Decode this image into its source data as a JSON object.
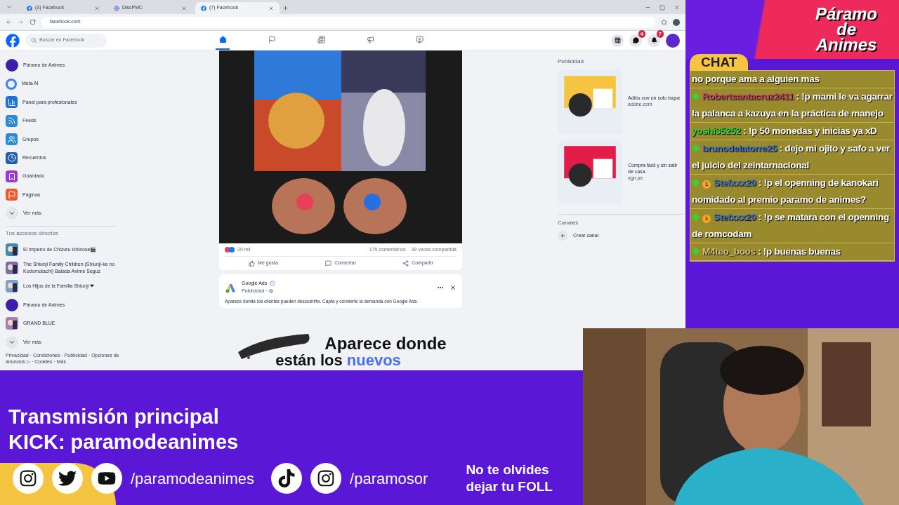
{
  "browser": {
    "tabs": [
      {
        "label": "(3) Facebook",
        "kind": "facebook",
        "selected": false
      },
      {
        "label": "DiscPMC",
        "kind": "disc",
        "selected": false
      },
      {
        "label": "(7) Facebook",
        "kind": "facebook",
        "selected": true
      }
    ],
    "address": "facebook.com"
  },
  "facebook": {
    "search": {
      "placeholder": "Buscar en Facebook"
    },
    "nav": [
      {
        "kind": "home",
        "selected": true
      },
      {
        "kind": "flag",
        "selected": false
      },
      {
        "kind": "news",
        "selected": false
      },
      {
        "kind": "megaphone",
        "selected": false
      },
      {
        "kind": "video",
        "selected": false
      }
    ],
    "header_buttons": [
      {
        "kind": "grid"
      },
      {
        "kind": "messenger",
        "badge": "4"
      },
      {
        "kind": "bell",
        "badge": "7"
      }
    ],
    "sidebar": [
      {
        "label": "Páramo de Animes",
        "kind": "avatar",
        "color": "#3b1fa8"
      },
      {
        "label": "Meta AI",
        "kind": "ring",
        "color": "#3b82f6"
      },
      {
        "label": "Panel para profesionales",
        "kind": "chart",
        "color": "#1d6fe0"
      },
      {
        "label": "Feeds",
        "kind": "feed",
        "color": "#2d88d8"
      },
      {
        "label": "Grupos",
        "kind": "groups",
        "color": "#2d88d8"
      },
      {
        "label": "Recuerdos",
        "kind": "clock",
        "color": "#1e5fb0"
      },
      {
        "label": "Guardado",
        "kind": "bookmark",
        "color": "#9b3bd6"
      },
      {
        "label": "Páginas",
        "kind": "flag",
        "color": "#ea5a2a"
      },
      {
        "label": "Ver más",
        "kind": "chevron",
        "color": "#e4e6eb"
      }
    ],
    "shortcuts_title": "Tus accesos directos",
    "shortcuts": [
      {
        "label": "El Imperio de Chizuru Ichinose🎬",
        "kind": "thumb",
        "color": "#3e8ca8"
      },
      {
        "label": "The Shiunji Family Children (Shiunji-ke no Kodomotachi) Balada Anime Seguz",
        "kind": "thumb",
        "color": "#7a6fa8"
      },
      {
        "label": "Los Hijos de la Familia Shiunji ❤",
        "kind": "thumb",
        "color": "#7aa0c8"
      },
      {
        "label": "Páramo de Animes",
        "kind": "avatar",
        "color": "#3b1fa8"
      },
      {
        "label": "GRAND BLUE",
        "kind": "thumb",
        "color": "#a880b0"
      },
      {
        "label": "Ver más",
        "kind": "chevron",
        "color": "#e4e6eb"
      }
    ],
    "footer": "Privacidad · Condiciones · Publicidad · Opciones de anuncios ▷ · Cookies · Más",
    "post": {
      "reactions": "20 mil",
      "comments": "179 comentarios",
      "shares": "39 veces compartida",
      "actions": [
        {
          "label": "Me gusta",
          "kind": "like"
        },
        {
          "label": "Comentar",
          "kind": "comment"
        },
        {
          "label": "Compartir",
          "kind": "share"
        }
      ]
    },
    "ad_post": {
      "author": "Google Ads",
      "verified": true,
      "meta": "Publicidad · ",
      "text": "Aparece donde los clientes pueden descubrirte. Capta y convierte la demanda con Google Ads.",
      "headline_1": "Aparece donde",
      "headline_2a": "están los ",
      "headline_2b": "nuevos"
    },
    "right": {
      "title": "Publicidad",
      "ads": [
        {
          "title": "Adiós con un solo toque",
          "domain": "adobe.com",
          "color": "#f5c542"
        },
        {
          "title": "Compra fácil y sin salir de casa",
          "domain": "agn.pe",
          "color": "#e11d48"
        }
      ],
      "channels_title": "Canales",
      "create_channel": "Crear canal"
    }
  },
  "stream": {
    "logo": [
      "Páramo",
      "de",
      "Animes"
    ],
    "chat_title": "CHAT",
    "chat": [
      {
        "kind": "continuation",
        "text": "no porque ama a alguien mas"
      },
      {
        "kind": "member",
        "user": "Robertsantacruz2411",
        "color": "#c0406a",
        "coin": false,
        "text": " : !p mami le va agarrar la palanca a kazuya en la práctica de manejo"
      },
      {
        "kind": "guest",
        "user": "yoshi35252",
        "color": "#34d33a",
        "coin": false,
        "text": " : !p 50 monedas y inicias ya xD"
      },
      {
        "kind": "member",
        "user": "brunodelatorre25",
        "color": "#3a72c8",
        "coin": false,
        "text": " : dejo mi ojito y safo a ver el juicio del zeintarnacional"
      },
      {
        "kind": "member",
        "user": "Stefxxx20",
        "color": "#3a72c8",
        "coin": true,
        "coin_label": "1",
        "text": " : !p el openning de kanokari nomidado al premio paramo de animes?"
      },
      {
        "kind": "member",
        "user": "Stefxxx20",
        "color": "#3a72c8",
        "coin": true,
        "coin_label": "1",
        "text": " : !p se matara con el openning de romcodam"
      },
      {
        "kind": "member",
        "user": "M4teo_boos",
        "color": "#d9c27a",
        "coin": false,
        "text": " : !p buenas buenas"
      }
    ],
    "banner": {
      "line_1": "Transmisión principal",
      "line_2": "KICK: paramodeanimes",
      "socials": [
        {
          "kind": "instagram"
        },
        {
          "kind": "twitter"
        },
        {
          "kind": "youtube"
        },
        {
          "kind": "handle",
          "text": "/paramodeanimes"
        },
        {
          "kind": "tiktok"
        },
        {
          "kind": "instagram"
        },
        {
          "kind": "handle",
          "text": "/paramosor"
        }
      ],
      "reminder_1": "No te olvides",
      "reminder_2": "dejar tu FOLL"
    }
  }
}
